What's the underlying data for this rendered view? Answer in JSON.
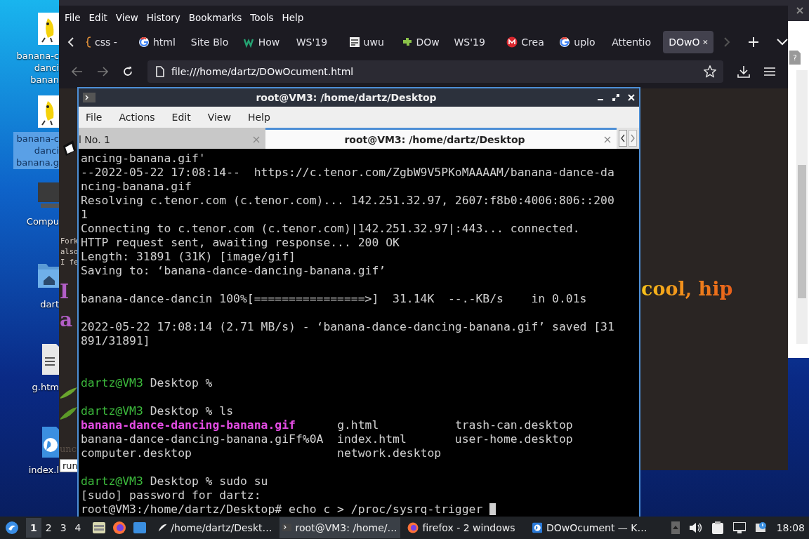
{
  "desktop": {
    "icons": [
      {
        "kind": "gif",
        "label": [
          "banana-c",
          "danci",
          "banan"
        ],
        "selected": false
      },
      {
        "kind": "gif",
        "label": [
          "banana-c",
          "danci",
          "banana.g"
        ],
        "selected": true
      },
      {
        "kind": "computer",
        "label": [
          "Compu"
        ],
        "selected": false
      },
      {
        "kind": "folder",
        "label": [
          "dart"
        ],
        "selected": false
      },
      {
        "kind": "document",
        "label": [
          "g.htm"
        ],
        "selected": false
      },
      {
        "kind": "webpage",
        "label": [
          "index.l"
        ],
        "selected": false
      }
    ]
  },
  "side_window": {
    "file_mark": "?"
  },
  "browser": {
    "menu": [
      "File",
      "Edit",
      "View",
      "History",
      "Bookmarks",
      "Tools",
      "Help"
    ],
    "tabs": [
      {
        "label": "css -",
        "kind": "css",
        "selected": false
      },
      {
        "label": "html",
        "kind": "google",
        "selected": false
      },
      {
        "label": "Site Blo",
        "kind": "plain",
        "selected": false
      },
      {
        "label": "How",
        "kind": "wikihow",
        "selected": false
      },
      {
        "label": "WS'19",
        "kind": "plain",
        "selected": false
      },
      {
        "label": "uwu",
        "kind": "binary",
        "selected": false
      },
      {
        "label": "DOw",
        "kind": "puzzle",
        "selected": false
      },
      {
        "label": "WS'19",
        "kind": "plain",
        "selected": false
      },
      {
        "label": "Crea",
        "kind": "mega",
        "selected": false
      },
      {
        "label": "uplo",
        "kind": "google",
        "selected": false
      },
      {
        "label": "Attentio",
        "kind": "plain",
        "selected": false
      },
      {
        "label": "DOwO",
        "kind": "plain",
        "selected": true
      }
    ],
    "url": "file:///home/dartz/DOwOcument.html",
    "page": {
      "side_lines": [
        "Fork",
        "also",
        "I fe"
      ],
      "heading_left": [
        "I",
        "a"
      ],
      "heading_right": "cool, hip",
      "fragment": "unc",
      "tooltip": "run"
    }
  },
  "terminal": {
    "title": "root@VM3: /home/dartz/Desktop",
    "menu": [
      "File",
      "Actions",
      "Edit",
      "View",
      "Help"
    ],
    "tabs": [
      {
        "label": "l No. 1",
        "selected": false
      },
      {
        "label": "root@VM3: /home/dartz/Desktop",
        "selected": true
      }
    ],
    "lines": [
      {
        "segments": [
          {
            "text": "ancing-banana.gif'",
            "kind": "plain"
          }
        ]
      },
      {
        "segments": [
          {
            "text": "--2022-05-22 17:08:14--  https://c.tenor.com/ZgbW9V5PKoMAAAAM/banana-dance-da",
            "kind": "plain"
          }
        ]
      },
      {
        "segments": [
          {
            "text": "ncing-banana.gif",
            "kind": "plain"
          }
        ]
      },
      {
        "segments": [
          {
            "text": "Resolving c.tenor.com (c.tenor.com)... 142.251.32.97, 2607:f8b0:4006:806::200",
            "kind": "plain"
          }
        ]
      },
      {
        "segments": [
          {
            "text": "1",
            "kind": "plain"
          }
        ]
      },
      {
        "segments": [
          {
            "text": "Connecting to c.tenor.com (c.tenor.com)|142.251.32.97|:443... connected.",
            "kind": "plain"
          }
        ]
      },
      {
        "segments": [
          {
            "text": "HTTP request sent, awaiting response... 200 OK",
            "kind": "plain"
          }
        ]
      },
      {
        "segments": [
          {
            "text": "Length: 31891 (31K) [image/gif]",
            "kind": "plain"
          }
        ]
      },
      {
        "segments": [
          {
            "text": "Saving to: ‘banana-dance-dancing-banana.gif’",
            "kind": "plain"
          }
        ]
      },
      {
        "kind": "spaced",
        "segments": [
          {
            "text": "banana-dance-dancin 100%[================>]  31.14K  --.-KB/s    in 0.01s",
            "kind": "plain"
          }
        ]
      },
      {
        "kind": "spaced",
        "segments": [
          {
            "text": "2022-05-22 17:08:14 (2.71 MB/s) - ‘banana-dance-dancing-banana.gif’ saved [31",
            "kind": "plain"
          }
        ]
      },
      {
        "segments": [
          {
            "text": "891/31891]",
            "kind": "plain"
          }
        ]
      },
      {
        "kind": "double-spaced",
        "segments": [
          {
            "text": "dartz@VM3",
            "kind": "prompt"
          },
          {
            "text": " Desktop %",
            "kind": "plain"
          }
        ]
      },
      {
        "kind": "spaced",
        "segments": [
          {
            "text": "dartz@VM3",
            "kind": "prompt"
          },
          {
            "text": " Desktop % ls",
            "kind": "plain"
          }
        ]
      },
      {
        "segments": [
          {
            "text": "banana-dance-dancing-banana.gif",
            "kind": "exec"
          },
          {
            "text": "      g.html           trash-can.desktop",
            "kind": "plain"
          }
        ]
      },
      {
        "segments": [
          {
            "text": "banana-dance-dancing-banana.giFf%0A  index.html       user-home.desktop",
            "kind": "plain"
          }
        ]
      },
      {
        "segments": [
          {
            "text": "computer.desktop                     network.desktop",
            "kind": "plain"
          }
        ]
      },
      {
        "kind": "spaced",
        "segments": [
          {
            "text": "dartz@VM3",
            "kind": "prompt"
          },
          {
            "text": " Desktop % sudo su",
            "kind": "plain"
          }
        ]
      },
      {
        "segments": [
          {
            "text": "[sudo] password for dartz:",
            "kind": "plain"
          }
        ]
      },
      {
        "segments": [
          {
            "text": "root@VM3:/home/dartz/Desktop# echo c > /proc/sysrq-trigger ",
            "kind": "plain"
          }
        ]
      }
    ]
  },
  "taskbar": {
    "workspaces": [
      {
        "label": "1",
        "selected": true
      },
      {
        "label": "2",
        "selected": false
      },
      {
        "label": "3",
        "selected": false
      },
      {
        "label": "4",
        "selected": false
      }
    ],
    "tasks": [
      {
        "label": "/home/dartz/Deskt…",
        "kind": "browser",
        "selected": false
      },
      {
        "label": "root@VM3: /home/…",
        "kind": "terminal",
        "selected": true
      },
      {
        "label": "firefox - 2 windows",
        "kind": "firefox",
        "selected": false
      },
      {
        "label": "DOwOcument — K…",
        "kind": "globe",
        "selected": false
      }
    ],
    "clock": "18:08"
  }
}
